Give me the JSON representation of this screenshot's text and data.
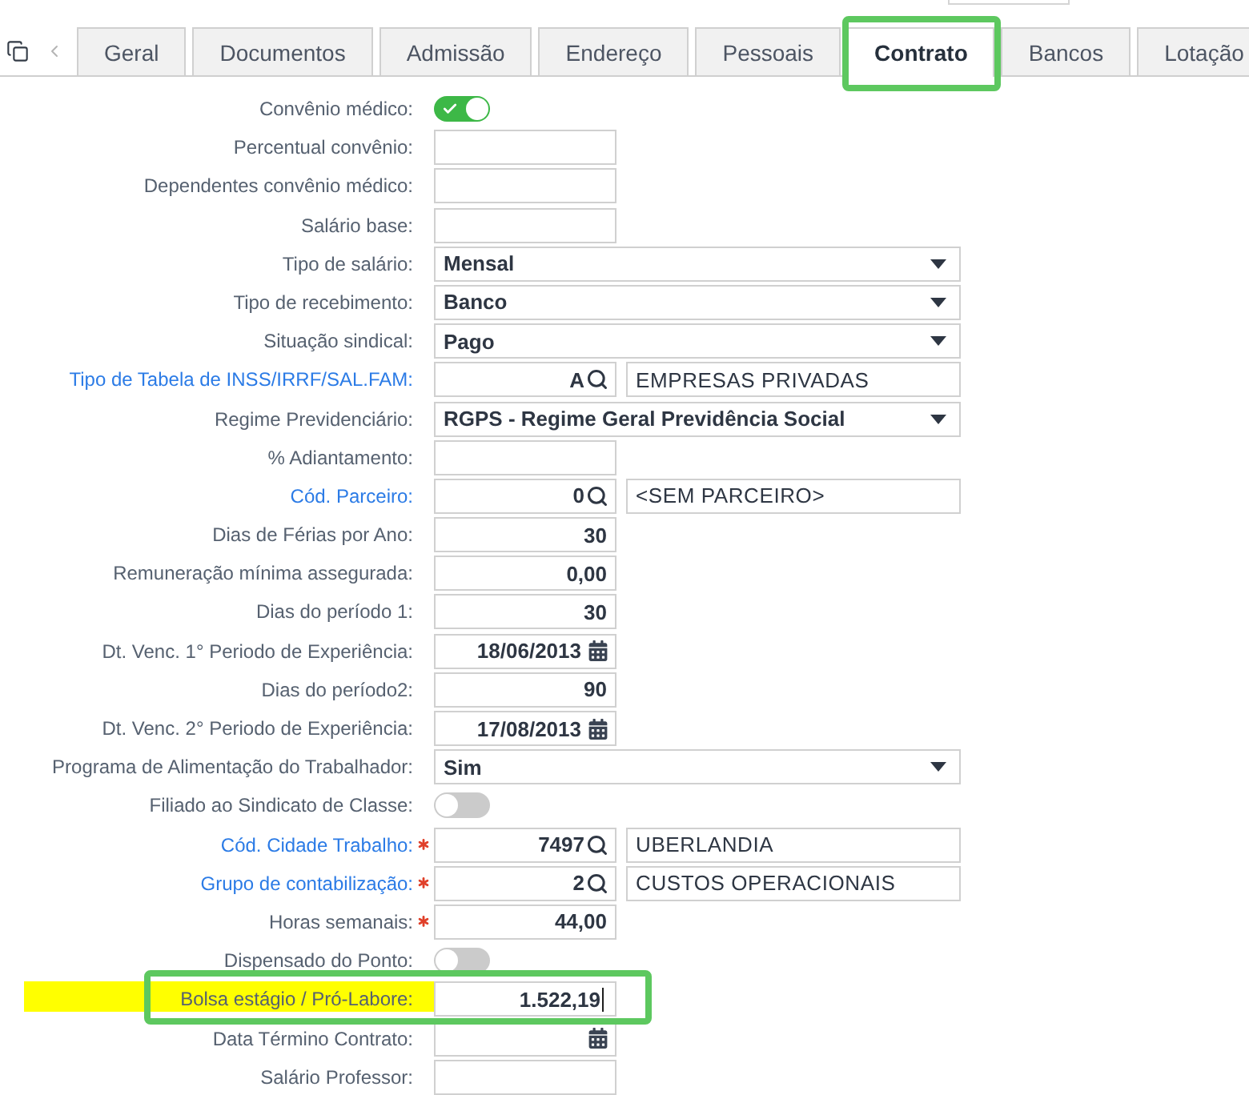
{
  "tabs": [
    {
      "label": "Geral",
      "selected": false,
      "highlighted": false
    },
    {
      "label": "Documentos",
      "selected": false,
      "highlighted": false
    },
    {
      "label": "Admissão",
      "selected": false,
      "highlighted": false
    },
    {
      "label": "Endereço",
      "selected": false,
      "highlighted": false
    },
    {
      "label": "Pessoais",
      "selected": false,
      "highlighted": false
    },
    {
      "label": "Contrato",
      "selected": true,
      "highlighted": true
    },
    {
      "label": "Bancos",
      "selected": false,
      "highlighted": false
    },
    {
      "label": "Lotação",
      "selected": false,
      "highlighted": false
    }
  ],
  "form": {
    "rows": [
      {
        "label": "Convênio médico:",
        "kind": "toggle",
        "on": true,
        "link": false,
        "required": false,
        "highlighted": false,
        "focused": false
      },
      {
        "label": "Percentual convênio:",
        "kind": "text",
        "link": false,
        "required": false,
        "highlighted": false,
        "focused": false
      },
      {
        "label": "Dependentes convênio médico:",
        "kind": "text",
        "link": false,
        "required": false,
        "highlighted": false,
        "focused": false
      },
      {
        "label": "Salário base:",
        "kind": "text",
        "link": false,
        "required": false,
        "highlighted": false,
        "focused": false
      },
      {
        "label": "Tipo de salário:",
        "kind": "select",
        "value": "Mensal",
        "link": false,
        "required": false,
        "highlighted": false,
        "focused": false
      },
      {
        "label": "Tipo de recebimento:",
        "kind": "select",
        "value": "Banco",
        "link": false,
        "required": false,
        "highlighted": false,
        "focused": false
      },
      {
        "label": "Situação sindical:",
        "kind": "select",
        "value": "Pago",
        "link": false,
        "required": false,
        "highlighted": false,
        "focused": false
      },
      {
        "label": "Tipo de Tabela de INSS/IRRF/SAL.FAM:",
        "kind": "lookup",
        "value": "A",
        "description": "EMPRESAS PRIVADAS",
        "link": true,
        "required": false,
        "highlighted": false,
        "focused": false
      },
      {
        "label": "Regime Previdenciário:",
        "kind": "select",
        "value": "RGPS - Regime Geral Previdência Social",
        "link": false,
        "required": false,
        "highlighted": false,
        "focused": false
      },
      {
        "label": "% Adiantamento:",
        "kind": "text",
        "link": false,
        "required": false,
        "highlighted": false,
        "focused": false
      },
      {
        "label": "Cód. Parceiro:",
        "kind": "lookup",
        "value": "0",
        "description": "<SEM PARCEIRO>",
        "link": true,
        "required": false,
        "highlighted": false,
        "focused": false
      },
      {
        "label": "Dias de Férias por Ano:",
        "kind": "text",
        "value": "30",
        "link": false,
        "required": false,
        "highlighted": false,
        "focused": false
      },
      {
        "label": "Remuneração mínima assegurada:",
        "kind": "text",
        "value": "0,00",
        "link": false,
        "required": false,
        "highlighted": false,
        "focused": false
      },
      {
        "label": "Dias do período 1:",
        "kind": "text",
        "value": "30",
        "link": false,
        "required": false,
        "highlighted": false,
        "focused": false
      },
      {
        "label": "Dt. Venc. 1° Periodo de Experiência:",
        "kind": "date",
        "value": "18/06/2013",
        "link": false,
        "required": false,
        "highlighted": false,
        "focused": false
      },
      {
        "label": "Dias do período2:",
        "kind": "text",
        "value": "90",
        "link": false,
        "required": false,
        "highlighted": false,
        "focused": false
      },
      {
        "label": "Dt. Venc. 2° Periodo de Experiência:",
        "kind": "date",
        "value": "17/08/2013",
        "link": false,
        "required": false,
        "highlighted": false,
        "focused": false
      },
      {
        "label": "Programa de Alimentação do Trabalhador:",
        "kind": "select",
        "value": "Sim",
        "link": false,
        "required": false,
        "highlighted": false,
        "focused": false
      },
      {
        "label": "Filiado ao Sindicato de Classe:",
        "kind": "toggle",
        "on": false,
        "link": false,
        "required": false,
        "highlighted": false,
        "focused": false
      },
      {
        "label": "Cód. Cidade Trabalho:",
        "kind": "lookup",
        "value": "7497",
        "description": "UBERLANDIA",
        "link": true,
        "required": true,
        "highlighted": false,
        "focused": false
      },
      {
        "label": "Grupo de contabilização:",
        "kind": "lookup",
        "value": "2",
        "description": "CUSTOS OPERACIONAIS",
        "link": true,
        "required": true,
        "highlighted": false,
        "focused": false
      },
      {
        "label": "Horas semanais:",
        "kind": "text",
        "value": "44,00",
        "link": false,
        "required": true,
        "highlighted": false,
        "focused": false
      },
      {
        "label": "Dispensado do Ponto:",
        "kind": "toggle",
        "on": false,
        "link": false,
        "required": false,
        "highlighted": false,
        "focused": false
      },
      {
        "label": "Bolsa estágio / Pró-Labore:",
        "kind": "text",
        "value": "1.522,19",
        "link": false,
        "required": false,
        "highlighted": true,
        "focused": true
      },
      {
        "label": "Data Término Contrato:",
        "kind": "date",
        "link": false,
        "required": false,
        "highlighted": false,
        "focused": false
      },
      {
        "label": "Salário Professor:",
        "kind": "text",
        "link": false,
        "required": false,
        "highlighted": false,
        "focused": false
      }
    ]
  }
}
